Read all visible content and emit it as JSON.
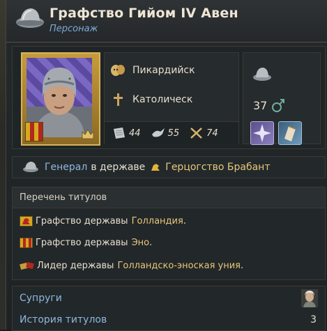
{
  "header": {
    "title": "Графство Гийом IV Авен",
    "subtitle": "Персонаж",
    "icon": "helmet-icon"
  },
  "character": {
    "culture": "Пикардийск",
    "religion": "Католическ",
    "age": "37",
    "gender_icon": "male-icon",
    "skills": [
      {
        "name": "administrative",
        "icon": "scroll-icon",
        "value": "44"
      },
      {
        "name": "diplomatic",
        "icon": "dove-icon",
        "value": "55"
      },
      {
        "name": "military",
        "icon": "crossed-swords-icon",
        "value": "74"
      }
    ]
  },
  "general": {
    "role": "Генерал",
    "in_state": "в державе",
    "state_name": "Герцогство Брабант"
  },
  "titles": {
    "header": "Перечень титулов",
    "items": [
      {
        "prefix": "Графство державы",
        "name": "Голландия",
        "suffix": ".",
        "flag": "lion-flag"
      },
      {
        "prefix": "Графство державы",
        "name": "Эно",
        "suffix": ".",
        "flag": "quartered-flag"
      },
      {
        "prefix": "Лидер державы",
        "name": "Голландско-эноская уния",
        "suffix": ".",
        "flag": "union-icon"
      }
    ]
  },
  "bottom": {
    "spouses_label": "Супруги",
    "title_history_label": "История титулов",
    "title_history_count": "3"
  },
  "colors": {
    "link_blue": "#8fb7e0",
    "gold": "#e8c77a",
    "subtitle_blue": "#7ea9d6"
  }
}
